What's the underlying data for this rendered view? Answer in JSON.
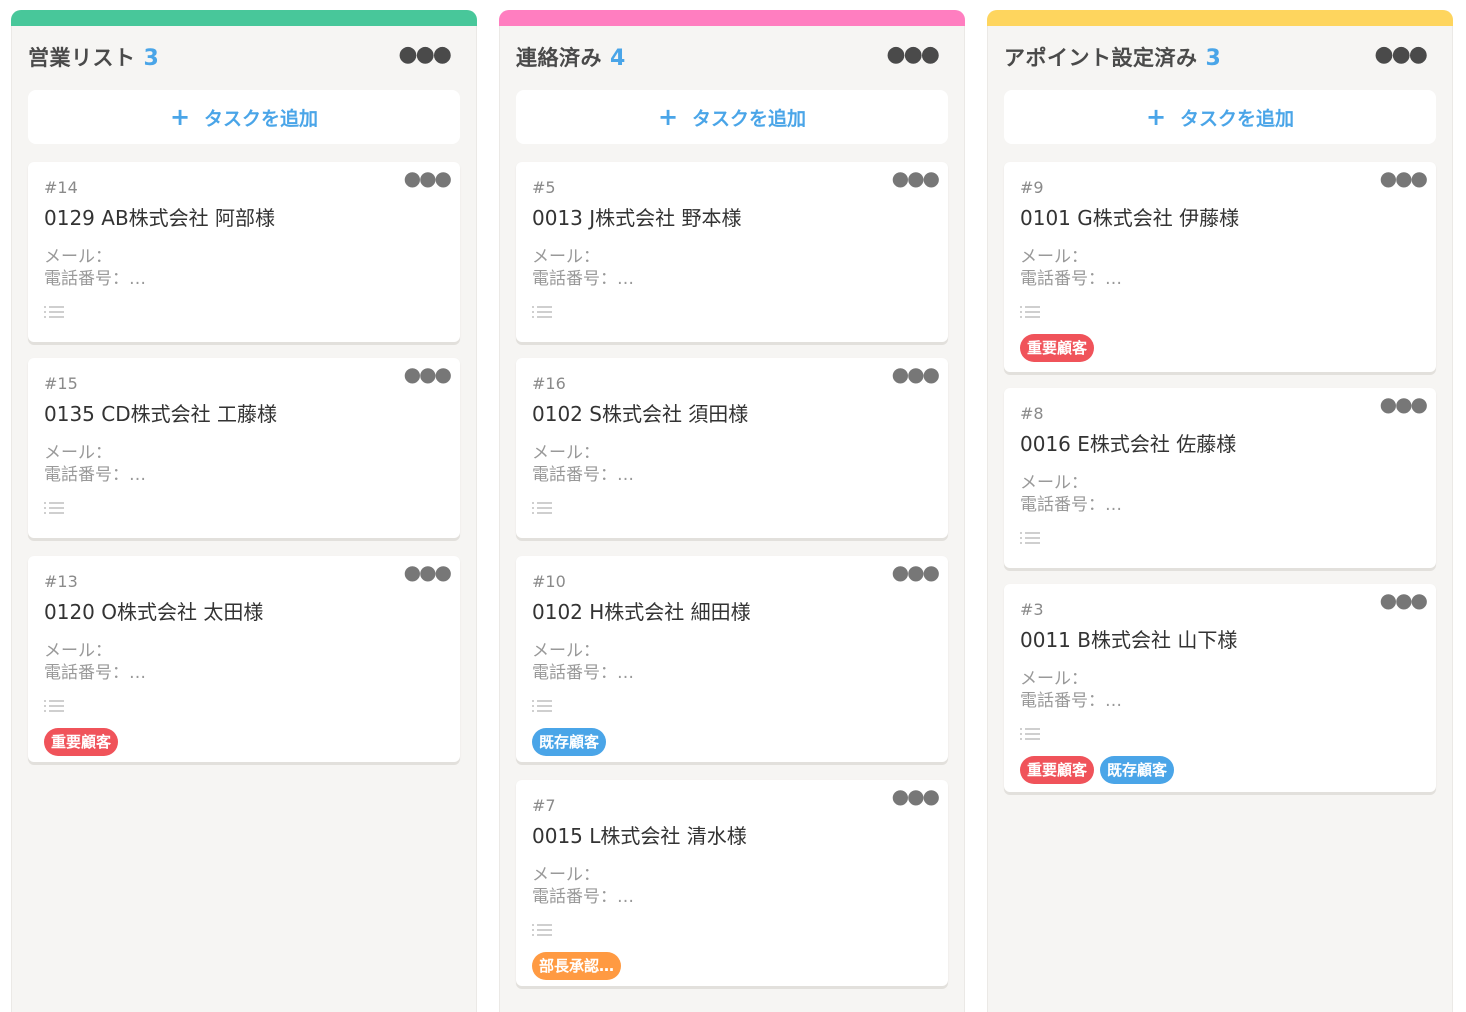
{
  "colors": {
    "accent": "#4aa5e8",
    "important": "#f0535a",
    "existing": "#4aa5e8",
    "approval": "#ff9a42"
  },
  "columns": [
    {
      "title": "営業リスト",
      "count": "3",
      "bar_color": "#48c79a",
      "add_label": "タスクを追加",
      "add_icon": "plus-icon",
      "cards": [
        {
          "id": "#14",
          "title": "0129 AB株式会社 阿部様",
          "mail": "メール：",
          "phone": "電話番号：…",
          "tags": []
        },
        {
          "id": "#15",
          "title": "0135 CD株式会社 工藤様",
          "mail": "メール：",
          "phone": "電話番号：…",
          "tags": []
        },
        {
          "id": "#13",
          "title": "0120 O株式会社 太田様",
          "mail": "メール：",
          "phone": "電話番号：…",
          "tags": [
            {
              "label": "重要顧客",
              "color": "#f0535a"
            }
          ]
        }
      ]
    },
    {
      "title": "連絡済み",
      "count": "4",
      "bar_color": "#ff7ec0",
      "add_label": "タスクを追加",
      "add_icon": "plus-icon",
      "cards": [
        {
          "id": "#5",
          "title": "0013 J株式会社 野本様",
          "mail": "メール：",
          "phone": "電話番号：…",
          "tags": []
        },
        {
          "id": "#16",
          "title": "0102 S株式会社 須田様",
          "mail": "メール：",
          "phone": "電話番号：…",
          "tags": []
        },
        {
          "id": "#10",
          "title": "0102 H株式会社 細田様",
          "mail": "メール：",
          "phone": "電話番号：…",
          "tags": [
            {
              "label": "既存顧客",
              "color": "#4aa5e8"
            }
          ]
        },
        {
          "id": "#7",
          "title": "0015 L株式会社 清水様",
          "mail": "メール：",
          "phone": "電話番号：…",
          "tags": [
            {
              "label": "部長承認…",
              "color": "#ff9a42"
            }
          ]
        }
      ]
    },
    {
      "title": "アポイント設定済み",
      "count": "3",
      "bar_color": "#fed55e",
      "add_label": "タスクを追加",
      "add_icon": "plus-icon",
      "cards": [
        {
          "id": "#9",
          "title": "0101 G株式会社 伊藤様",
          "mail": "メール：",
          "phone": "電話番号：…",
          "tags": [
            {
              "label": "重要顧客",
              "color": "#f0535a"
            }
          ]
        },
        {
          "id": "#8",
          "title": "0016 E株式会社 佐藤様",
          "mail": "メール：",
          "phone": "電話番号：…",
          "tags": []
        },
        {
          "id": "#3",
          "title": "0011 B株式会社 山下様",
          "mail": "メール：",
          "phone": "電話番号：…",
          "tags": [
            {
              "label": "重要顧客",
              "color": "#f0535a"
            },
            {
              "label": "既存顧客",
              "color": "#4aa5e8"
            }
          ]
        }
      ]
    }
  ]
}
